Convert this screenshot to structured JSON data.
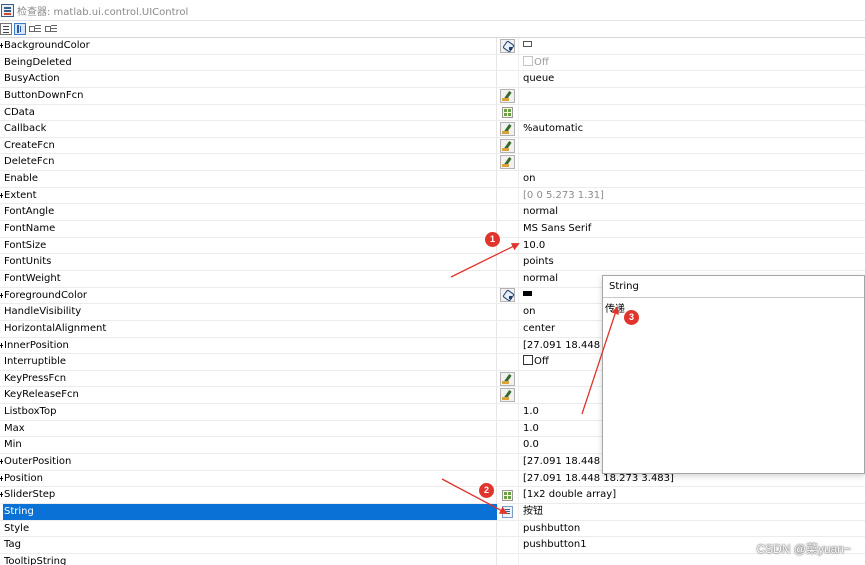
{
  "window": {
    "title": "检查器: matlab.ui.control.UIControl"
  },
  "toolbar": {
    "buttons": [
      "categorize-icon",
      "sort-alpha-icon",
      "expand-all-icon",
      "collapse-all-icon"
    ]
  },
  "properties": [
    {
      "name": "BackgroundColor",
      "value": "",
      "editor": "color",
      "swatch": "white",
      "expandable": true
    },
    {
      "name": "BeingDeleted",
      "value": "Off",
      "checkbox": "disabled"
    },
    {
      "name": "BusyAction",
      "value": "queue"
    },
    {
      "name": "ButtonDownFcn",
      "value": "",
      "editor": "callback"
    },
    {
      "name": "CData",
      "value": "",
      "editor": "matrix"
    },
    {
      "name": "Callback",
      "value": "%automatic",
      "editor": "callback"
    },
    {
      "name": "CreateFcn",
      "value": "",
      "editor": "callback"
    },
    {
      "name": "DeleteFcn",
      "value": "",
      "editor": "callback"
    },
    {
      "name": "Enable",
      "value": "on"
    },
    {
      "name": "Extent",
      "value": "[0 0 5.273 1.31]",
      "gray": true,
      "expandable": true
    },
    {
      "name": "FontAngle",
      "value": "normal"
    },
    {
      "name": "FontName",
      "value": "MS Sans Serif"
    },
    {
      "name": "FontSize",
      "value": "10.0"
    },
    {
      "name": "FontUnits",
      "value": "points"
    },
    {
      "name": "FontWeight",
      "value": "normal"
    },
    {
      "name": "ForegroundColor",
      "value": "",
      "editor": "color",
      "swatch": "black",
      "expandable": true
    },
    {
      "name": "HandleVisibility",
      "value": "on"
    },
    {
      "name": "HorizontalAlignment",
      "value": "center"
    },
    {
      "name": "InnerPosition",
      "value": "[27.091 18.448 18.",
      "expandable": true
    },
    {
      "name": "Interruptible",
      "value": "Off",
      "checkbox": "enabled"
    },
    {
      "name": "KeyPressFcn",
      "value": "",
      "editor": "callback"
    },
    {
      "name": "KeyReleaseFcn",
      "value": "",
      "editor": "callback"
    },
    {
      "name": "ListboxTop",
      "value": "1.0"
    },
    {
      "name": "Max",
      "value": "1.0"
    },
    {
      "name": "Min",
      "value": "0.0"
    },
    {
      "name": "OuterPosition",
      "value": "[27.091 18.448 18.",
      "expandable": true
    },
    {
      "name": "Position",
      "value": "[27.091 18.448 18.273 3.483]",
      "expandable": true
    },
    {
      "name": "SliderStep",
      "value": "[1x2  double array]",
      "editor": "matrix",
      "expandable": true
    },
    {
      "name": "String",
      "value": "按钮",
      "editor": "string",
      "selected": true
    },
    {
      "name": "Style",
      "value": "pushbutton"
    },
    {
      "name": "Tag",
      "value": "pushbutton1"
    },
    {
      "name": "TooltipString",
      "value": ""
    }
  ],
  "string_popup": {
    "title": "String",
    "text": "传递"
  },
  "annotations": [
    {
      "label": "1"
    },
    {
      "label": "2"
    },
    {
      "label": "3"
    }
  ],
  "annotation_color": "#e0342c",
  "selection_color": "#0a72d6",
  "watermark": "CSDN @菜yuan~"
}
